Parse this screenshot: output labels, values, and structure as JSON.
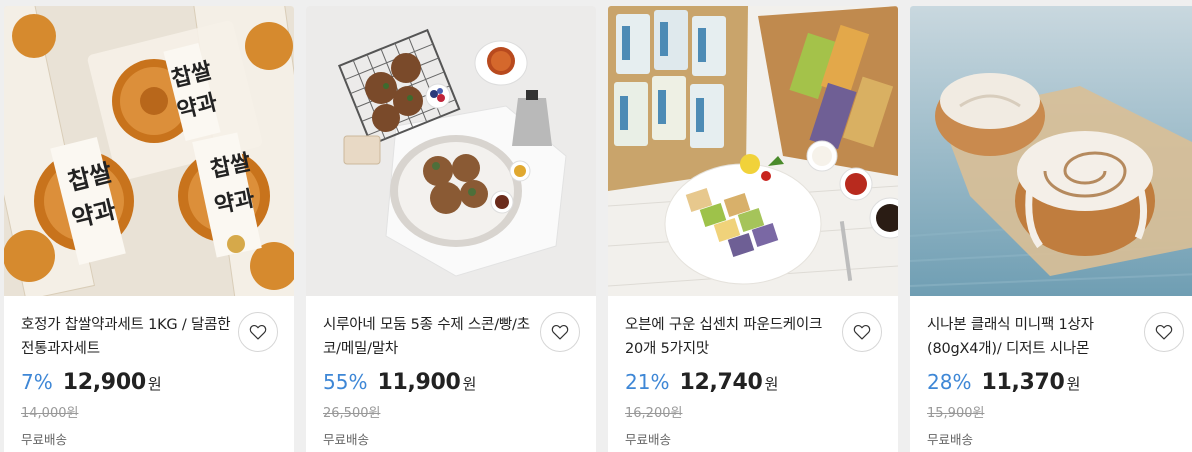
{
  "products": [
    {
      "title": "호정가 찹쌀약과세트 1KG / 달콤한 전통과자세트",
      "discount": "7%",
      "price": "12,900",
      "currency": "원",
      "original_price": "14,000원",
      "shipping": "무료배송",
      "image_text": [
        "찹쌀",
        "약과"
      ]
    },
    {
      "title": "시루아네 모둠 5종 수제 스콘/빵/초코/메밀/말차",
      "discount": "55%",
      "price": "11,900",
      "currency": "원",
      "original_price": "26,500원",
      "shipping": "무료배송"
    },
    {
      "title": "오븐에 구운 십센치 파운드케이크 20개 5가지맛",
      "discount": "21%",
      "price": "12,740",
      "currency": "원",
      "original_price": "16,200원",
      "shipping": "무료배송"
    },
    {
      "title": "시나본 클래식 미니팩 1상자 (80gX4개)/ 디저트 시나몬",
      "discount": "28%",
      "price": "11,370",
      "currency": "원",
      "original_price": "15,900원",
      "shipping": "무료배송"
    }
  ],
  "colors": {
    "discount": "#3e87d6",
    "price": "#222222",
    "muted": "#999999",
    "background": "#efefef"
  },
  "icons": {
    "favorite": "heart-outline-icon"
  }
}
